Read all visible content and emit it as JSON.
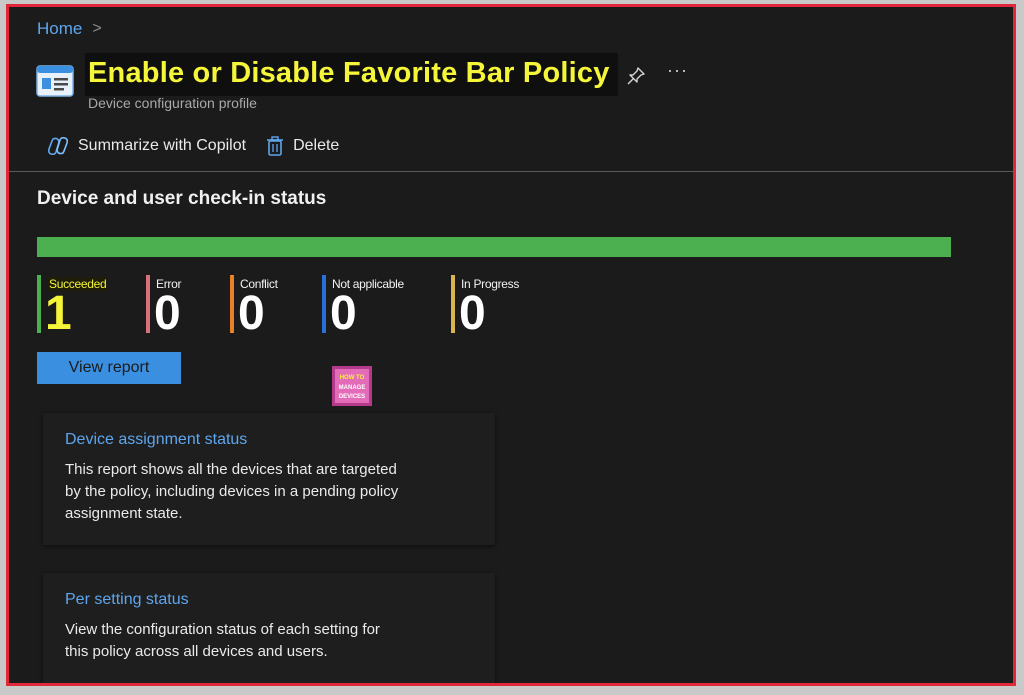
{
  "breadcrumb": {
    "home": "Home",
    "separator": ">"
  },
  "header": {
    "title": "Enable or Disable Favorite Bar Policy",
    "subtitle": "Device configuration profile",
    "more": "···"
  },
  "toolbar": {
    "summarize_label": "Summarize with Copilot",
    "delete_label": "Delete"
  },
  "status": {
    "section_title": "Device and user check-in status",
    "progress_fraction": 1.0,
    "stats": [
      {
        "label": "Succeeded",
        "value": "1",
        "color": "#4caf50"
      },
      {
        "label": "Error",
        "value": "0",
        "color": "#d9707a"
      },
      {
        "label": "Conflict",
        "value": "0",
        "color": "#e8812a"
      },
      {
        "label": "Not applicable",
        "value": "0",
        "color": "#2a6fd6"
      },
      {
        "label": "In Progress",
        "value": "0",
        "color": "#d9b54f"
      }
    ],
    "view_report_label": "View report"
  },
  "watermark": {
    "line1": "HOW TO",
    "line2": "MANAGE",
    "line3": "DEVICES"
  },
  "cards": [
    {
      "title": "Device assignment status",
      "description": "This report shows all the devices that are targeted by the policy, including devices in a pending policy assignment state."
    },
    {
      "title": "Per setting status",
      "description": "View the configuration status of each setting for this policy across all devices and users."
    }
  ],
  "colors": {
    "accent": "#5ea6ee",
    "highlight": "#f5f53a",
    "border": "#e0283a",
    "success": "#4caf50"
  }
}
